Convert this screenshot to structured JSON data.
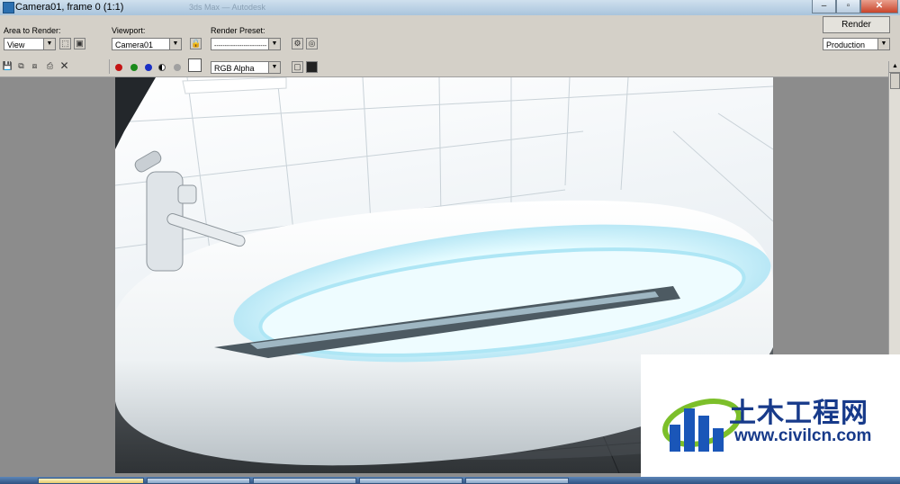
{
  "window": {
    "title": "Camera01, frame 0 (1:1)",
    "ghost_title": "3ds Max — Autodesk"
  },
  "window_controls": {
    "minimize": "–",
    "maximize": "▫",
    "close": "✕"
  },
  "area_to_render": {
    "label": "Area to Render:",
    "value": "View"
  },
  "viewport": {
    "label": "Viewport:",
    "value": "Camera01"
  },
  "render_preset": {
    "label": "Render Preset:",
    "value": "-------------------------"
  },
  "render_button": {
    "label": "Render"
  },
  "production": {
    "value": "Production"
  },
  "channel": {
    "value": "RGB Alpha"
  },
  "colors": {
    "red": "#c41414",
    "green": "#1a8a1a",
    "blue": "#1a2fc4",
    "accent": "#2b6fb0"
  },
  "watermark": {
    "chinese": "土木工程网",
    "url": "www.civilcn.com"
  }
}
